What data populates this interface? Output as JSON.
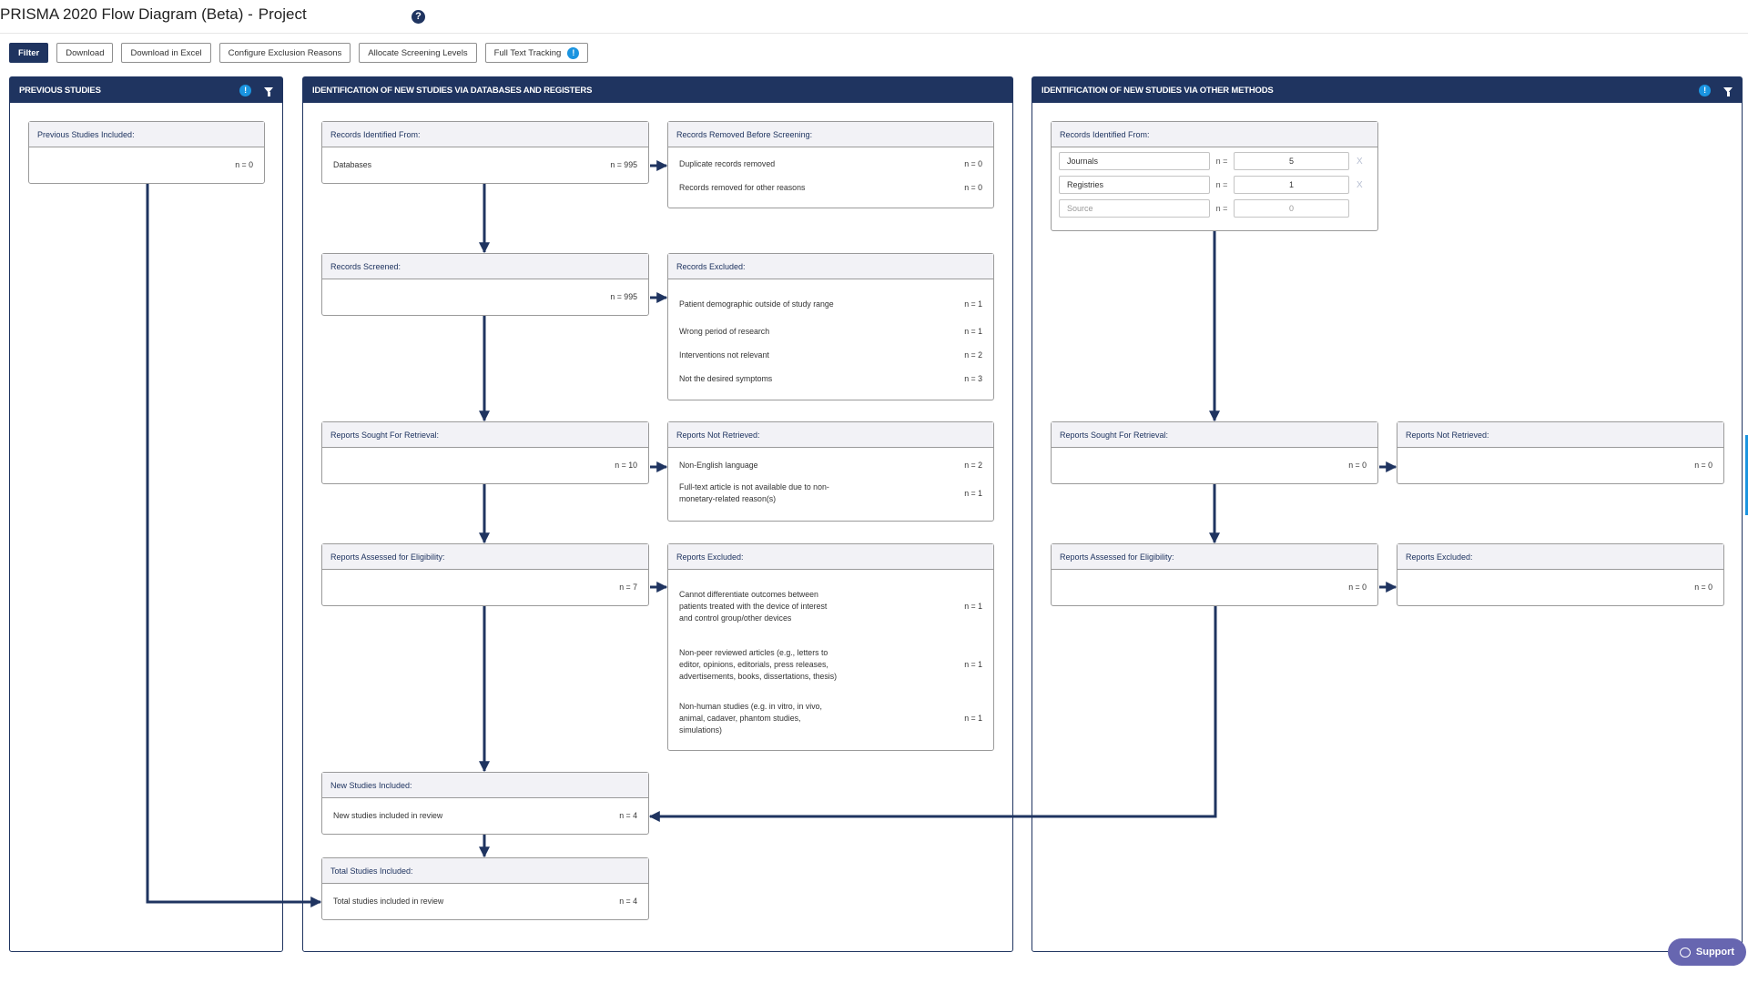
{
  "header": {
    "title": "PRISMA 2020 Flow Diagram (Beta) -",
    "project": "Project",
    "help_icon": "?"
  },
  "toolbar": {
    "filter": "Filter",
    "download": "Download",
    "download_excel": "Download in Excel",
    "configure_exclusion": "Configure Exclusion Reasons",
    "allocate_levels": "Allocate Screening Levels",
    "full_text_tracking": "Full Text Tracking",
    "info_icon": "!"
  },
  "panels": {
    "previous": {
      "title": "PREVIOUS STUDIES",
      "info_icon": "!",
      "included": {
        "title": "Previous Studies Included:",
        "n": "n = 0"
      }
    },
    "databases": {
      "title": "IDENTIFICATION OF NEW STUDIES VIA DATABASES AND REGISTERS",
      "records_identified": {
        "title": "Records Identified From:",
        "rows": [
          {
            "label": "Databases",
            "n": "n = 995"
          }
        ]
      },
      "records_removed": {
        "title": "Records Removed Before Screening:",
        "rows": [
          {
            "label": "Duplicate records removed",
            "n": "n = 0"
          },
          {
            "label": "Records removed for other reasons",
            "n": "n = 0"
          }
        ]
      },
      "records_screened": {
        "title": "Records Screened:",
        "n": "n = 995"
      },
      "records_excluded": {
        "title": "Records Excluded:",
        "rows": [
          {
            "label": "Patient demographic outside of study range",
            "n": "n = 1"
          },
          {
            "label": "Wrong period of research",
            "n": "n = 1"
          },
          {
            "label": "Interventions not relevant",
            "n": "n = 2"
          },
          {
            "label": "Not the desired symptoms",
            "n": "n = 3"
          }
        ]
      },
      "reports_sought": {
        "title": "Reports Sought For Retrieval:",
        "n": "n = 10"
      },
      "reports_not_retrieved": {
        "title": "Reports Not Retrieved:",
        "rows": [
          {
            "label": "Non-English language",
            "n": "n = 2"
          },
          {
            "label": "Full-text article is not available due to non-monetary-related reason(s)",
            "n": "n = 1"
          }
        ]
      },
      "reports_assessed": {
        "title": "Reports Assessed for Eligibility:",
        "n": "n = 7"
      },
      "reports_excluded": {
        "title": "Reports Excluded:",
        "rows": [
          {
            "label": "Cannot differentiate outcomes between patients treated with the device of interest and control group/other devices",
            "n": "n = 1"
          },
          {
            "label": "Non-peer reviewed articles (e.g., letters to editor, opinions, editorials, press releases, advertisements, books, dissertations, thesis)",
            "n": "n = 1"
          },
          {
            "label": "Non-human studies (e.g. in vitro, in vivo, animal, cadaver, phantom studies, simulations)",
            "n": "n = 1"
          }
        ]
      },
      "new_included": {
        "title": "New Studies Included:",
        "label": "New studies included in review",
        "n": "n = 4"
      },
      "total_included": {
        "title": "Total Studies Included:",
        "label": "Total studies included in review",
        "n": "n = 4"
      }
    },
    "other": {
      "title": "IDENTIFICATION OF NEW STUDIES VIA OTHER METHODS",
      "info_icon": "!",
      "records_identified": {
        "title": "Records Identified From:",
        "n_label": "n =",
        "remove_label": "X",
        "sources": [
          {
            "name": "Journals",
            "count": "5"
          },
          {
            "name": "Registries",
            "count": "1"
          }
        ],
        "new_source_placeholder": "Source",
        "new_count_placeholder": "0"
      },
      "reports_sought": {
        "title": "Reports Sought For Retrieval:",
        "n": "n = 0"
      },
      "reports_not_retrieved": {
        "title": "Reports Not Retrieved:",
        "n": "n = 0"
      },
      "reports_assessed": {
        "title": "Reports Assessed for Eligibility:",
        "n": "n = 0"
      },
      "reports_excluded": {
        "title": "Reports Excluded:",
        "n": "n = 0"
      }
    }
  },
  "support": {
    "label": "Support"
  }
}
